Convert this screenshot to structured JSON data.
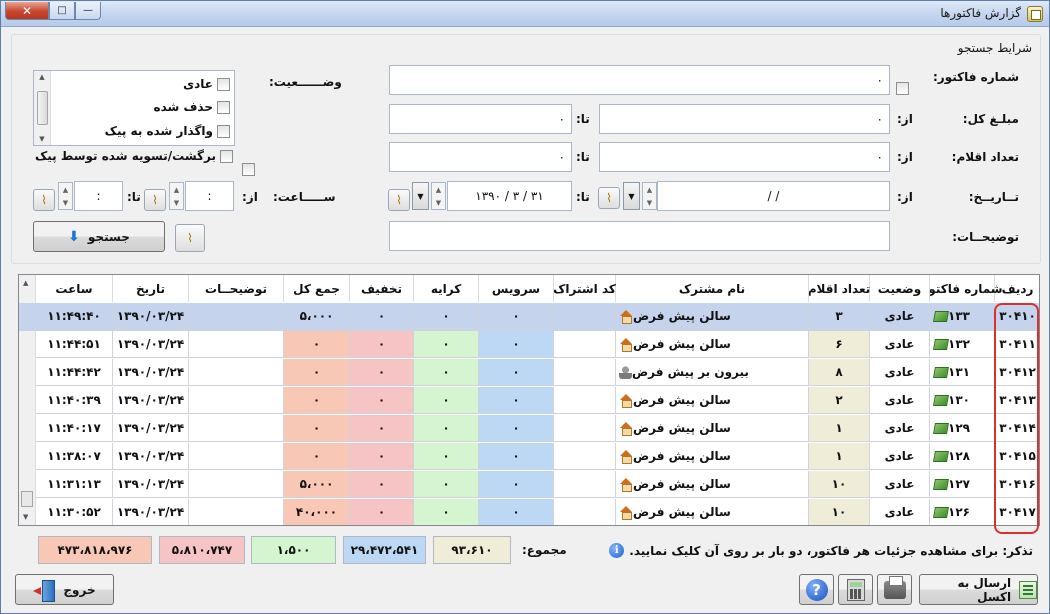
{
  "window": {
    "title": "گزارش فاکتورها"
  },
  "search": {
    "group_title": "شرایط جستجو",
    "invoice_no_label": "شماره فاکتور:",
    "invoice_no_value": "۰",
    "total_label": "مبلـغ کل:",
    "count_label": "تعداد اقلام:",
    "date_label": "تــاریــخ:",
    "desc_label": "توضیحــات:",
    "from_label": "از:",
    "to_label": "تا:",
    "total_from": "۰",
    "total_to": "۰",
    "count_from": "۰",
    "count_to": "۰",
    "date_from": "/       /",
    "date_to": "۱۳۹۰ / ۳ / ۳۱",
    "status_label": "وضــــــعیت:",
    "status_options": [
      "عادی",
      "حذف شده",
      "واگذار شده به پیک",
      "برگشت/تسویه شده توسط پیک"
    ],
    "time_label": "ســـــاعت:",
    "time_from": ":",
    "time_to": ":",
    "search_button": "جستجو"
  },
  "grid": {
    "columns": [
      "ردیف",
      "شماره فاکتور",
      "وضعیت",
      "تعداد اقلام",
      "نام مشترک",
      "کد اشتراک",
      "سرویس",
      "کرایه",
      "تخفیف",
      "جمع کل",
      "توضیحــات",
      "تاریخ",
      "ساعت"
    ],
    "rows": [
      {
        "row": "۳۰۴۱۰",
        "invoice": "۱۳۳",
        "status": "عادی",
        "items": "۳",
        "customer": "سالن پیش فرض",
        "customer_icon": "house-icon",
        "code": "",
        "service": "۰",
        "fare": "۰",
        "discount": "۰",
        "total": "۵،۰۰۰",
        "desc": "",
        "date": "۱۳۹۰/۰۳/۲۴",
        "time": "۱۱:۴۹:۴۰"
      },
      {
        "row": "۳۰۴۱۱",
        "invoice": "۱۳۲",
        "status": "عادی",
        "items": "۶",
        "customer": "سالن پیش فرض",
        "customer_icon": "house-icon",
        "code": "",
        "service": "۰",
        "fare": "۰",
        "discount": "۰",
        "total": "۰",
        "desc": "",
        "date": "۱۳۹۰/۰۳/۲۴",
        "time": "۱۱:۴۴:۵۱"
      },
      {
        "row": "۳۰۴۱۲",
        "invoice": "۱۳۱",
        "status": "عادی",
        "items": "۸",
        "customer": "بیرون بر پیش فرض",
        "customer_icon": "person-icon",
        "code": "",
        "service": "۰",
        "fare": "۰",
        "discount": "۰",
        "total": "۰",
        "desc": "",
        "date": "۱۳۹۰/۰۳/۲۴",
        "time": "۱۱:۴۴:۴۲"
      },
      {
        "row": "۳۰۴۱۳",
        "invoice": "۱۳۰",
        "status": "عادی",
        "items": "۲",
        "customer": "سالن پیش فرض",
        "customer_icon": "house-icon",
        "code": "",
        "service": "۰",
        "fare": "۰",
        "discount": "۰",
        "total": "۰",
        "desc": "",
        "date": "۱۳۹۰/۰۳/۲۴",
        "time": "۱۱:۴۰:۳۹"
      },
      {
        "row": "۳۰۴۱۴",
        "invoice": "۱۲۹",
        "status": "عادی",
        "items": "۱",
        "customer": "سالن پیش فرض",
        "customer_icon": "house-icon",
        "code": "",
        "service": "۰",
        "fare": "۰",
        "discount": "۰",
        "total": "۰",
        "desc": "",
        "date": "۱۳۹۰/۰۳/۲۴",
        "time": "۱۱:۴۰:۱۷"
      },
      {
        "row": "۳۰۴۱۵",
        "invoice": "۱۲۸",
        "status": "عادی",
        "items": "۱",
        "customer": "سالن پیش فرض",
        "customer_icon": "house-icon",
        "code": "",
        "service": "۰",
        "fare": "۰",
        "discount": "۰",
        "total": "۰",
        "desc": "",
        "date": "۱۳۹۰/۰۳/۲۴",
        "time": "۱۱:۳۸:۰۷"
      },
      {
        "row": "۳۰۴۱۶",
        "invoice": "۱۲۷",
        "status": "عادی",
        "items": "۱۰",
        "customer": "سالن پیش فرض",
        "customer_icon": "house-icon",
        "code": "",
        "service": "۰",
        "fare": "۰",
        "discount": "۰",
        "total": "۵،۰۰۰",
        "desc": "",
        "date": "۱۳۹۰/۰۳/۲۴",
        "time": "۱۱:۳۱:۱۳"
      },
      {
        "row": "۳۰۴۱۷",
        "invoice": "۱۲۶",
        "status": "عادی",
        "items": "۱۰",
        "customer": "سالن پیش فرض",
        "customer_icon": "house-icon",
        "code": "",
        "service": "۰",
        "fare": "۰",
        "discount": "۰",
        "total": "۴۰،۰۰۰",
        "desc": "",
        "date": "۱۳۹۰/۰۳/۲۴",
        "time": "۱۱:۳۰:۵۲"
      }
    ]
  },
  "totals": {
    "hint": "تذکر: برای مشاهده جزئیات هر فاکتور، دو بار بر روی آن کلیک نمایید.",
    "sum_label": "مجموع:",
    "items_sum": "۹۳،۶۱۰",
    "service_sum": "۲۹،۴۷۲،۵۴۱",
    "fare_sum": "۱،۵۰۰",
    "discount_sum": "۵،۸۱۰،۷۴۷",
    "total_sum": "۴۷۳،۸۱۸،۹۷۶"
  },
  "footer": {
    "excel_button": "ارسال به اکسل",
    "exit_button": "خروج"
  },
  "colors": {
    "items_col": "#efecd8",
    "service_col": "#bcd8f5",
    "fare_col": "#d4f5cf",
    "discount_col": "#f7c4c6",
    "total_col": "#f9c7b5",
    "selected_row": "#c5d3ec"
  }
}
